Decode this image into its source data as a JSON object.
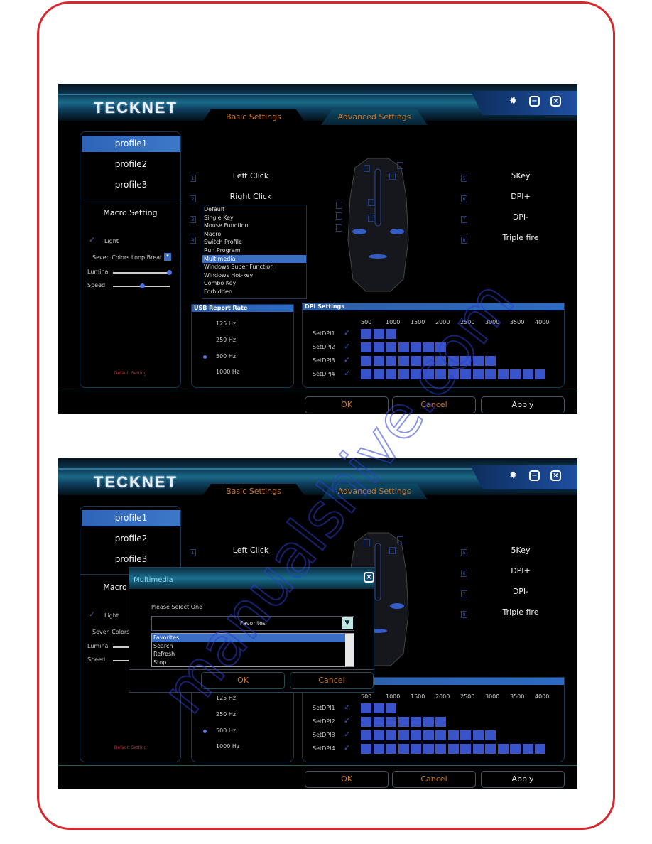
{
  "app": {
    "logo": "TECKNET",
    "tabs": [
      "Basic Settings",
      "Advanced Settings"
    ],
    "window_icons": [
      "gear-icon",
      "minimize-icon",
      "close-icon"
    ],
    "profiles": [
      "profile1",
      "profile2",
      "profile3"
    ],
    "selected_profile": "profile1",
    "macro_setting": "Macro Setting",
    "light_label": "Light",
    "light_checked": true,
    "light_mode": "Seven Colors Loop Breat",
    "lumina_label": "Lumina",
    "lumina_value": 1.0,
    "speed_label": "Speed",
    "speed_value": 0.5,
    "default_setting": "Default Setting",
    "left_buttons": [
      {
        "num": "1",
        "label": "Left Click"
      },
      {
        "num": "2",
        "label": "Right Click"
      },
      {
        "num": "3",
        "label": ""
      },
      {
        "num": "4",
        "label": ""
      }
    ],
    "function_list": [
      "Default",
      "Single Key",
      "Mouse Function",
      "Macro",
      "Switch Profile",
      "Run Program",
      "Multimedia",
      "Windows Super Function",
      "Windows Hot-key",
      "Combo Key",
      "Forbidden"
    ],
    "function_selected": "Multimedia",
    "right_buttons": [
      {
        "num": "5",
        "label": "5Key"
      },
      {
        "num": "6",
        "label": "DPI+"
      },
      {
        "num": "7",
        "label": "DPI-"
      },
      {
        "num": "8",
        "label": "Triple fire"
      }
    ],
    "usb": {
      "title": "USB Report Rate",
      "rates": [
        "125 Hz",
        "250 Hz",
        "500 Hz",
        "1000 Hz"
      ],
      "selected": "500 Hz"
    },
    "dpi": {
      "title": "DPI Settings",
      "scale": [
        "500",
        "1000",
        "1500",
        "2000",
        "2500",
        "3000",
        "3500",
        "4000"
      ],
      "rows": [
        {
          "label": "SetDPI1",
          "checked": true,
          "level": 3
        },
        {
          "label": "SetDPI2",
          "checked": true,
          "level": 7
        },
        {
          "label": "SetDPI3",
          "checked": true,
          "level": 11
        },
        {
          "label": "SetDPI4",
          "checked": true,
          "level": 15
        }
      ]
    },
    "footer": {
      "ok": "OK",
      "cancel": "Cancel",
      "apply": "Apply"
    },
    "colors": {
      "accent": "#3a6fc4",
      "dpi_block": "#3854c8",
      "ok_cancel_text": "#c8742a",
      "page_border": "#d8262c"
    }
  },
  "dialog": {
    "title": "Multimedia",
    "prompt": "Please Select One",
    "selected": "Favorites",
    "options": [
      "Favorites",
      "Search",
      "Refresh",
      "Stop"
    ],
    "ok": "OK",
    "cancel": "Cancel"
  },
  "watermark": "manualshive.com"
}
